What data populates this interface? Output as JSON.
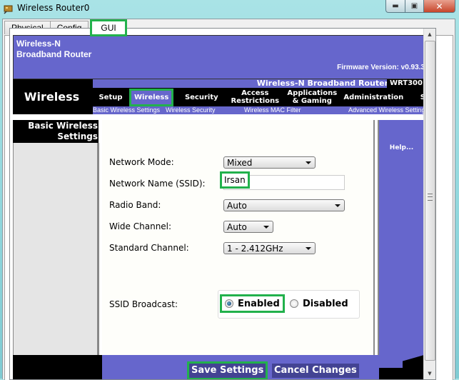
{
  "window": {
    "title": "Wireless Router0",
    "controls": {
      "minimize": "minimize",
      "maximize": "maximize",
      "close": "close"
    }
  },
  "tabs": [
    {
      "label": "Physical",
      "active": false
    },
    {
      "label": "Config",
      "active": false
    },
    {
      "label": "GUI",
      "active": true
    }
  ],
  "router": {
    "brand_line1": "Wireless-N",
    "brand_line2": "Broadband Router",
    "firmware": "Firmware Version: v0.93.3",
    "product_name": "Wireless-N Broadband Router",
    "model": "WRT300",
    "section_title": "Wireless"
  },
  "menu": [
    {
      "label": "Setup",
      "active": false
    },
    {
      "label": "Wireless",
      "active": true
    },
    {
      "label": "Security",
      "active": false
    },
    {
      "label": "Access\nRestrictions",
      "active": false
    },
    {
      "label": "Applications\n& Gaming",
      "active": false
    },
    {
      "label": "Administration",
      "active": false
    },
    {
      "label": "Status",
      "active": false
    }
  ],
  "submenu": [
    {
      "label": "Basic Wireless Settings",
      "active": true
    },
    {
      "label": "Wireless Security",
      "active": false
    },
    {
      "label": "Wireless MAC Filter",
      "active": false
    },
    {
      "label": "Advanced Wireless Settings",
      "active": false
    }
  ],
  "sidebar": {
    "heading_line1": "Basic Wireless",
    "heading_line2": "Settings"
  },
  "form": {
    "network_mode": {
      "label": "Network Mode:",
      "value": "Mixed"
    },
    "ssid": {
      "label": "Network Name (SSID):",
      "value": "Irsan"
    },
    "radio_band": {
      "label": "Radio Band:",
      "value": "Auto"
    },
    "wide_channel": {
      "label": "Wide Channel:",
      "value": "Auto"
    },
    "standard_channel": {
      "label": "Standard Channel:",
      "value": "1 - 2.412GHz"
    },
    "ssid_broadcast": {
      "label": "SSID Broadcast:",
      "options": [
        {
          "label": "Enabled",
          "checked": true
        },
        {
          "label": "Disabled",
          "checked": false
        }
      ]
    }
  },
  "help": {
    "label": "Help..."
  },
  "buttons": {
    "save": "Save Settings",
    "cancel": "Cancel Changes"
  },
  "colors": {
    "accent": "#6666CC",
    "highlight": "#22B14C",
    "button": "#434393"
  }
}
